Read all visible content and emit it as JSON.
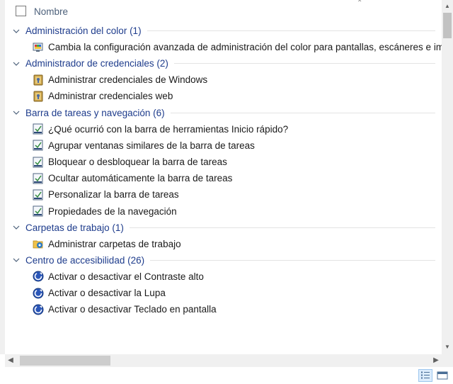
{
  "header": {
    "column_name": "Nombre"
  },
  "groups": [
    {
      "title": "Administración del color (1)",
      "items": [
        {
          "label": "Cambia la configuración avanzada de administración del color para pantallas, escáneres e impres",
          "icon": "color-management-icon"
        }
      ]
    },
    {
      "title": "Administrador de credenciales (2)",
      "items": [
        {
          "label": "Administrar credenciales de Windows",
          "icon": "credential-vault-icon"
        },
        {
          "label": "Administrar credenciales web",
          "icon": "credential-vault-icon"
        }
      ]
    },
    {
      "title": "Barra de tareas y navegación (6)",
      "items": [
        {
          "label": "¿Qué ocurrió con la barra de herramientas Inicio rápido?",
          "icon": "taskbar-icon"
        },
        {
          "label": "Agrupar ventanas similares de la barra de tareas",
          "icon": "taskbar-icon"
        },
        {
          "label": "Bloquear o desbloquear la barra de tareas",
          "icon": "taskbar-icon"
        },
        {
          "label": "Ocultar automáticamente la barra de tareas",
          "icon": "taskbar-icon"
        },
        {
          "label": "Personalizar la barra de tareas",
          "icon": "taskbar-icon"
        },
        {
          "label": "Propiedades de la navegación",
          "icon": "taskbar-icon"
        }
      ]
    },
    {
      "title": "Carpetas de trabajo (1)",
      "items": [
        {
          "label": "Administrar carpetas de trabajo",
          "icon": "work-folders-icon"
        }
      ]
    },
    {
      "title": "Centro de accesibilidad (26)",
      "items": [
        {
          "label": "Activar o desactivar el Contraste alto",
          "icon": "ease-of-access-icon"
        },
        {
          "label": "Activar o desactivar la Lupa",
          "icon": "ease-of-access-icon"
        },
        {
          "label": "Activar o desactivar Teclado en pantalla",
          "icon": "ease-of-access-icon"
        }
      ]
    }
  ],
  "colors": {
    "group_title": "#1e3c8c",
    "header_text": "#4c607a",
    "scrollbar_bg": "#f0f0f0",
    "scrollbar_thumb": "#c2c2c2"
  }
}
